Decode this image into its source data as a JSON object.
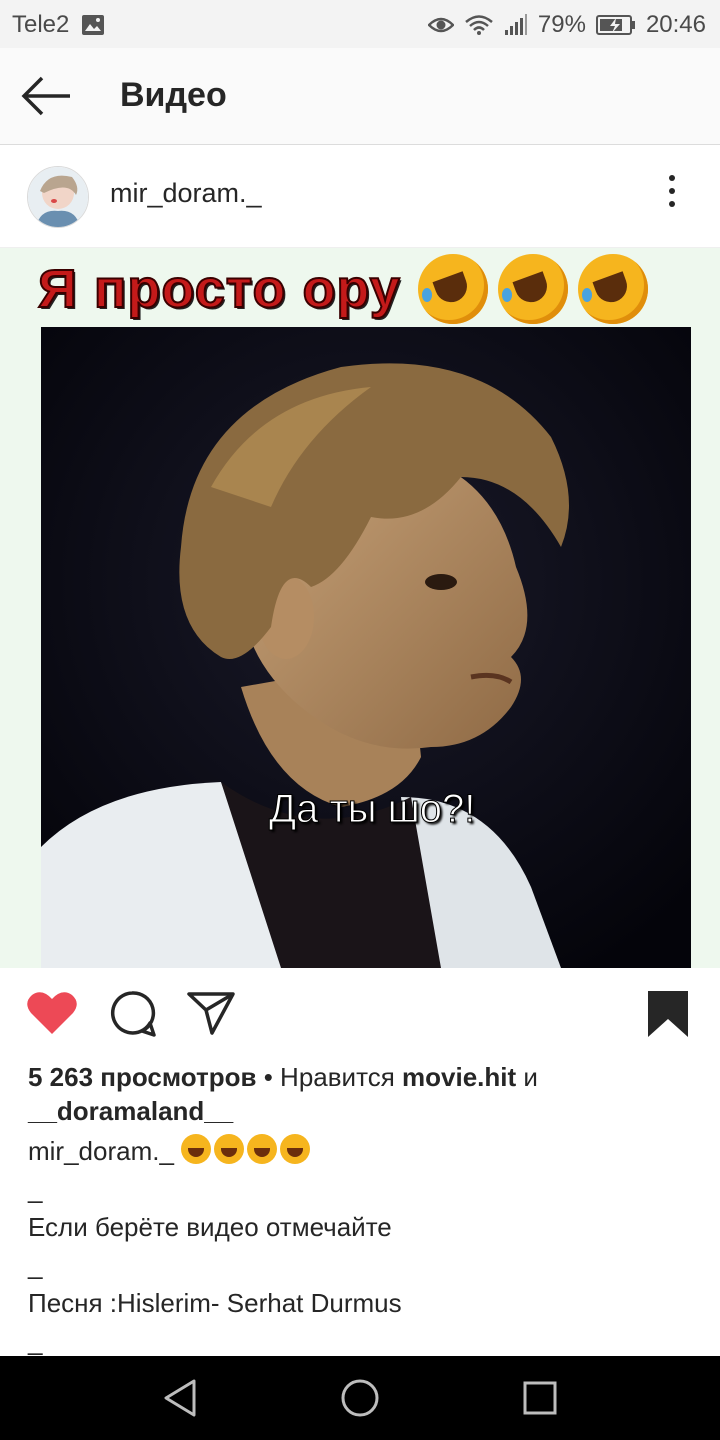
{
  "status_bar": {
    "carrier": "Tele2",
    "battery": "79%",
    "time": "20:46"
  },
  "header": {
    "title": "Видео"
  },
  "post": {
    "username": "mir_doram._",
    "video_caption": "Я просто ору",
    "video_subtitle": "Да ты шо?!",
    "views": "5 263 просмотров",
    "likes_prefix": "• Нравится",
    "liked_by_1": "movie.hit",
    "likes_and": "и",
    "liked_by_2": "__doramaland__",
    "caption_user": "mir_doram._",
    "caption_lines": [
      "_",
      "Если берёте видео отмечайте",
      "_",
      "Песня :Hislerim- Serhat Durmus",
      "_"
    ]
  },
  "colors": {
    "like_red": "#ed4956",
    "text": "#262626",
    "navbar": "#000000"
  },
  "icons": {
    "back": "arrow-left-icon",
    "more": "more-vertical-icon",
    "like": "heart-icon",
    "comment": "comment-icon",
    "share": "send-icon",
    "save": "bookmark-icon"
  }
}
